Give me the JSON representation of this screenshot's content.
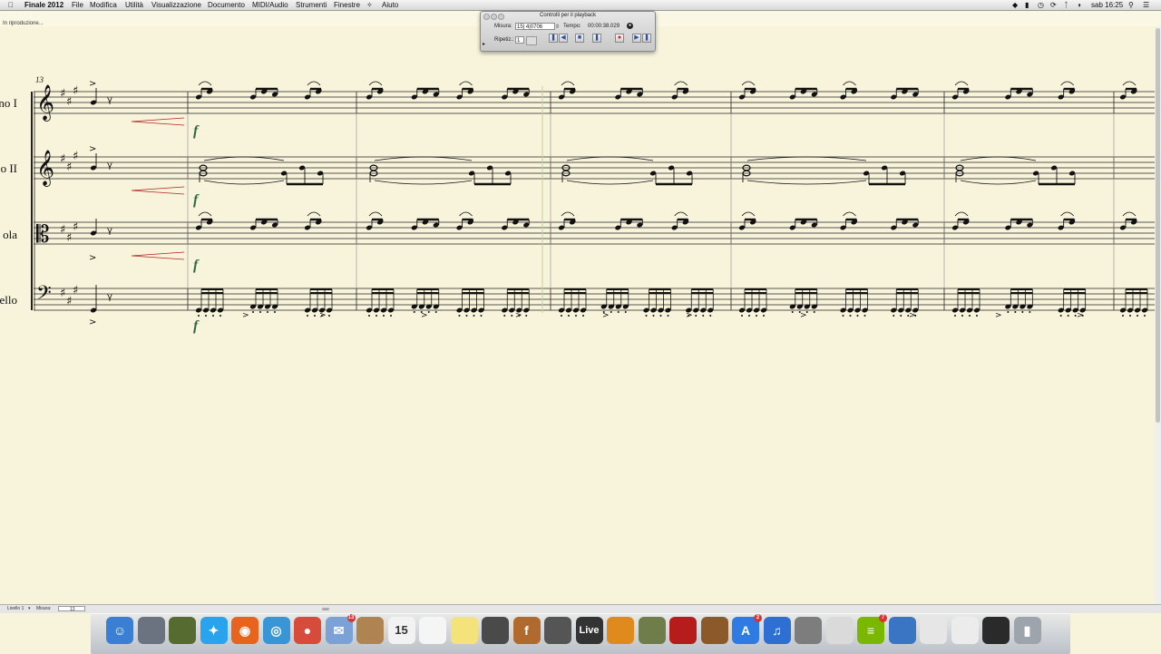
{
  "menubar": {
    "app": "Finale 2012",
    "items": [
      "File",
      "Modifica",
      "Utilità",
      "Visualizzazione",
      "Documento",
      "MIDI/Audio",
      "Strumenti",
      "Finestre",
      "Aiuto"
    ],
    "clock": "sab 16:25"
  },
  "status": "In riproduzione...",
  "playback": {
    "title": "Controlli per il playback",
    "measure_label": "Misura:",
    "measure_value": "15| 4|0706",
    "tempo_label": "Tempo:",
    "tempo_value": "00:00:38.029",
    "repeat_label": "Ripetiz.:",
    "repeat_value": "1"
  },
  "score": {
    "measure_number": "13",
    "instruments": [
      "no I",
      "o II",
      "ola",
      "ello"
    ],
    "dynamics": "f"
  },
  "bottombar": {
    "level_label": "Livello 1",
    "measure_label": "Misura:",
    "measure_value": "13"
  },
  "dock": {
    "items": [
      "finder",
      "launchpad",
      "system-prefs",
      "twitter",
      "firefox",
      "safari",
      "chrome",
      "mail",
      "contacts",
      "calendar",
      "reminders",
      "notes",
      "facetime",
      "finale",
      "scanner",
      "live",
      "garageband",
      "itunes-folder",
      "photobooth",
      "iphoto",
      "appstore",
      "itunes",
      "preferences",
      "preview",
      "spotify",
      "network",
      "folder-1",
      "folder-2",
      "folder-3",
      "trash"
    ],
    "badges": {
      "mail": "13",
      "appstore": "2",
      "spotify": "7"
    },
    "calendar_day": "15",
    "live_label": "Live"
  },
  "colors": {
    "paper": "#f8f4dc",
    "ink": "#111111",
    "dynamics": "#2f6a43",
    "hairpin": "#b22222",
    "barline": "#3a3a3a"
  }
}
